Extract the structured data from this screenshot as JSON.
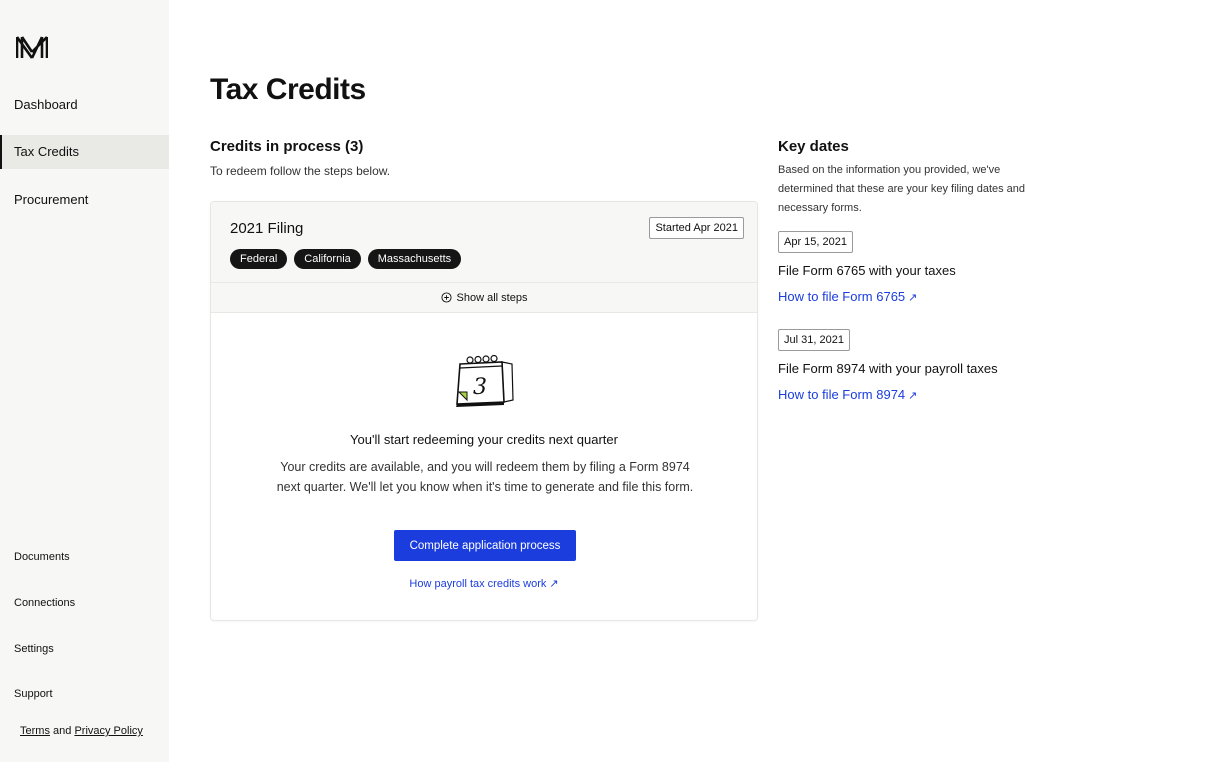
{
  "sidebar": {
    "logo": "M",
    "nav": [
      {
        "label": "Dashboard"
      },
      {
        "label": "Tax Credits"
      },
      {
        "label": "Procurement"
      }
    ],
    "footer": [
      {
        "label": "Documents"
      },
      {
        "label": "Connections"
      },
      {
        "label": "Settings"
      },
      {
        "label": "Support"
      }
    ],
    "legal": {
      "terms": "Terms",
      "and": "and",
      "privacy": "Privacy Policy"
    }
  },
  "main": {
    "title": "Tax Credits",
    "section_title": "Credits in process (3)",
    "section_sub": "To redeem follow the steps below.",
    "card": {
      "filing_title": "2021 Filing",
      "started": "Started Apr 2021",
      "chips": [
        "Federal",
        "California",
        "Massachusetts"
      ],
      "show_steps": "Show all steps",
      "calendar_day": "3",
      "empty_title": "You'll start redeeming your credits next quarter",
      "empty_body": "Your credits are available, and you will redeem them by filing a Form 8974 next quarter. We'll let you know when it's time to generate and file this form.",
      "button": "Complete application process",
      "link": "How payroll tax credits work"
    }
  },
  "key_dates": {
    "title": "Key dates",
    "description": "Based on the information you provided, we've determined that these are your key filing dates and necessary forms.",
    "items": [
      {
        "date": "Apr 15, 2021",
        "text": "File Form 6765 with your taxes",
        "link": "How to file Form 6765"
      },
      {
        "date": "Jul 31, 2021",
        "text": "File Form 8974 with your payroll taxes",
        "link": "How to file Form 8974"
      }
    ]
  },
  "icons": {
    "logo": "logo-icon",
    "plus": "plus-circle-icon",
    "calendar": "calendar-icon",
    "arrow": "arrow-up-right-icon"
  },
  "colors": {
    "accent": "#1b3ddd",
    "sidebar_bg": "#f7f7f5",
    "chip_bg": "#151515"
  }
}
